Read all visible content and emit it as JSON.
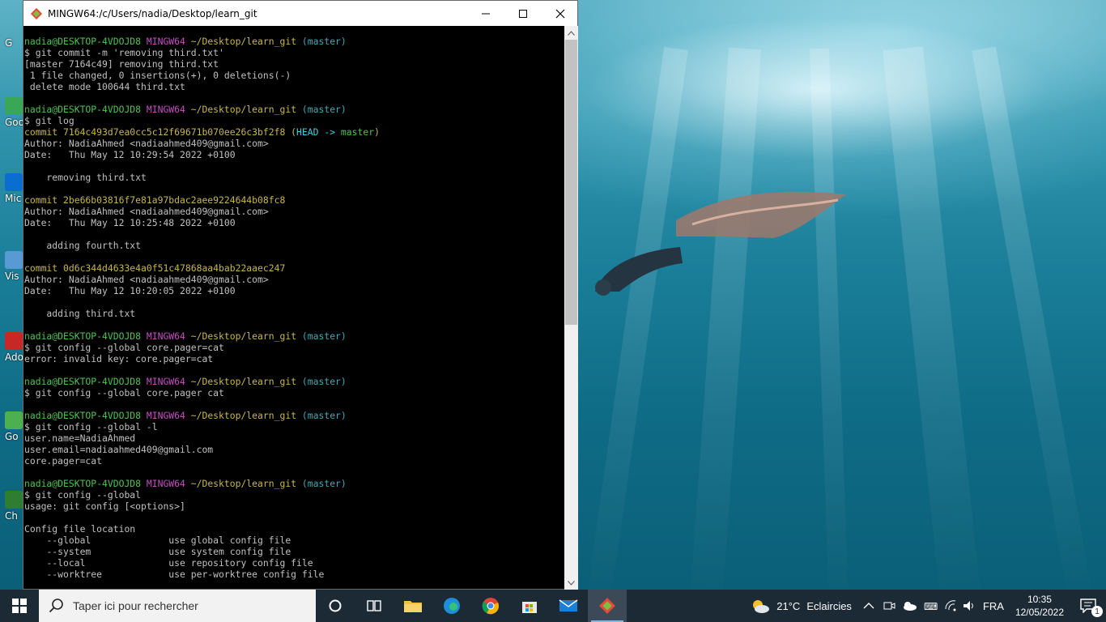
{
  "window": {
    "title": "MINGW64:/c/Users/nadia/Desktop/learn_git"
  },
  "desktop_icons": [
    {
      "label": "G",
      "color": "#2c7be5"
    },
    {
      "label": "Goo",
      "color": "#3aa757"
    },
    {
      "label": "Mic",
      "color": "#0a6ed1"
    },
    {
      "label": "Vis",
      "color": "#5a9ad4"
    },
    {
      "label": "Ado",
      "color": "#c62828"
    },
    {
      "label": "Go",
      "color": "#4caf50"
    },
    {
      "label": "Ch",
      "color": "#2e7d32"
    }
  ],
  "terminal": {
    "lines": [
      [
        {
          "t": "nadia@DESKTOP-4VDOJD8 ",
          "c": "g"
        },
        {
          "t": "MINGW64 ",
          "c": "m"
        },
        {
          "t": "~/Desktop/learn_git ",
          "c": "y"
        },
        {
          "t": "(master)",
          "c": "c"
        }
      ],
      [
        {
          "t": "$ git commit -m 'removing third.txt'",
          "c": ""
        }
      ],
      [
        {
          "t": "[master 7164c49] removing third.txt",
          "c": ""
        }
      ],
      [
        {
          "t": " 1 file changed, 0 insertions(+), 0 deletions(-)",
          "c": ""
        }
      ],
      [
        {
          "t": " delete mode 100644 third.txt",
          "c": ""
        }
      ],
      [
        {
          "t": "",
          "c": ""
        }
      ],
      [
        {
          "t": "nadia@DESKTOP-4VDOJD8 ",
          "c": "g"
        },
        {
          "t": "MINGW64 ",
          "c": "m"
        },
        {
          "t": "~/Desktop/learn_git ",
          "c": "y"
        },
        {
          "t": "(master)",
          "c": "c"
        }
      ],
      [
        {
          "t": "$ git log",
          "c": ""
        }
      ],
      [
        {
          "t": "commit 7164c493d7ea0cc5c12f69671b070ee26c3bf2f8 ",
          "c": "y"
        },
        {
          "t": "(",
          "c": "y"
        },
        {
          "t": "HEAD -> ",
          "c": "br"
        },
        {
          "t": "master",
          "c": "g"
        },
        {
          "t": ")",
          "c": "y"
        }
      ],
      [
        {
          "t": "Author: NadiaAhmed <nadiaahmed409@gmail.com>",
          "c": ""
        }
      ],
      [
        {
          "t": "Date:   Thu May 12 10:29:54 2022 +0100",
          "c": ""
        }
      ],
      [
        {
          "t": "",
          "c": ""
        }
      ],
      [
        {
          "t": "    removing third.txt",
          "c": ""
        }
      ],
      [
        {
          "t": "",
          "c": ""
        }
      ],
      [
        {
          "t": "commit 2be66b03816f7e81a97bdac2aee9224644b08fc8",
          "c": "y"
        }
      ],
      [
        {
          "t": "Author: NadiaAhmed <nadiaahmed409@gmail.com>",
          "c": ""
        }
      ],
      [
        {
          "t": "Date:   Thu May 12 10:25:48 2022 +0100",
          "c": ""
        }
      ],
      [
        {
          "t": "",
          "c": ""
        }
      ],
      [
        {
          "t": "    adding fourth.txt",
          "c": ""
        }
      ],
      [
        {
          "t": "",
          "c": ""
        }
      ],
      [
        {
          "t": "commit 0d6c344d4633e4a0f51c47868aa4bab22aaec247",
          "c": "y"
        }
      ],
      [
        {
          "t": "Author: NadiaAhmed <nadiaahmed409@gmail.com>",
          "c": ""
        }
      ],
      [
        {
          "t": "Date:   Thu May 12 10:20:05 2022 +0100",
          "c": ""
        }
      ],
      [
        {
          "t": "",
          "c": ""
        }
      ],
      [
        {
          "t": "    adding third.txt",
          "c": ""
        }
      ],
      [
        {
          "t": "",
          "c": ""
        }
      ],
      [
        {
          "t": "nadia@DESKTOP-4VDOJD8 ",
          "c": "g"
        },
        {
          "t": "MINGW64 ",
          "c": "m"
        },
        {
          "t": "~/Desktop/learn_git ",
          "c": "y"
        },
        {
          "t": "(master)",
          "c": "c"
        }
      ],
      [
        {
          "t": "$ git config --global core.pager=cat",
          "c": ""
        }
      ],
      [
        {
          "t": "error: invalid key: core.pager=cat",
          "c": ""
        }
      ],
      [
        {
          "t": "",
          "c": ""
        }
      ],
      [
        {
          "t": "nadia@DESKTOP-4VDOJD8 ",
          "c": "g"
        },
        {
          "t": "MINGW64 ",
          "c": "m"
        },
        {
          "t": "~/Desktop/learn_git ",
          "c": "y"
        },
        {
          "t": "(master)",
          "c": "c"
        }
      ],
      [
        {
          "t": "$ git config --global core.pager cat",
          "c": ""
        }
      ],
      [
        {
          "t": "",
          "c": ""
        }
      ],
      [
        {
          "t": "nadia@DESKTOP-4VDOJD8 ",
          "c": "g"
        },
        {
          "t": "MINGW64 ",
          "c": "m"
        },
        {
          "t": "~/Desktop/learn_git ",
          "c": "y"
        },
        {
          "t": "(master)",
          "c": "c"
        }
      ],
      [
        {
          "t": "$ git config --global -l",
          "c": ""
        }
      ],
      [
        {
          "t": "user.name=NadiaAhmed",
          "c": ""
        }
      ],
      [
        {
          "t": "user.email=nadiaahmed409@gmail.com",
          "c": ""
        }
      ],
      [
        {
          "t": "core.pager=cat",
          "c": ""
        }
      ],
      [
        {
          "t": "",
          "c": ""
        }
      ],
      [
        {
          "t": "nadia@DESKTOP-4VDOJD8 ",
          "c": "g"
        },
        {
          "t": "MINGW64 ",
          "c": "m"
        },
        {
          "t": "~/Desktop/learn_git ",
          "c": "y"
        },
        {
          "t": "(master)",
          "c": "c"
        }
      ],
      [
        {
          "t": "$ git config --global",
          "c": ""
        }
      ],
      [
        {
          "t": "usage: git config [<options>]",
          "c": ""
        }
      ],
      [
        {
          "t": "",
          "c": ""
        }
      ],
      [
        {
          "t": "Config file location",
          "c": ""
        }
      ],
      [
        {
          "t": "    --global              use global config file",
          "c": ""
        }
      ],
      [
        {
          "t": "    --system              use system config file",
          "c": ""
        }
      ],
      [
        {
          "t": "    --local               use repository config file",
          "c": ""
        }
      ],
      [
        {
          "t": "    --worktree            use per-worktree config file",
          "c": ""
        }
      ]
    ]
  },
  "taskbar": {
    "search_placeholder": "Taper ici pour rechercher",
    "apps": [
      "task-view-icon",
      "file-explorer-icon",
      "edge-icon",
      "chrome-icon",
      "store-icon",
      "mail-icon",
      "git-bash-icon"
    ],
    "weather": {
      "temp": "21°C",
      "condition": "Eclaircies"
    },
    "language": "FRA",
    "time": "10:35",
    "date": "12/05/2022",
    "notification_count": "1"
  }
}
